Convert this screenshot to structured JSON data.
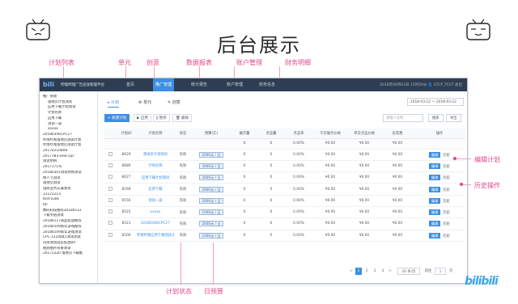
{
  "slide": {
    "title": "后台展示",
    "brand": "bilibili"
  },
  "annotations": {
    "plan_list": "计划列表",
    "unit": "单元",
    "creative": "创意",
    "data_report": "数据报表",
    "account_mgmt": "账户管理",
    "finance_detail": "财务明细",
    "edit_plan": "编辑计划",
    "history_ops": "历史操作",
    "plan_status": "计划状态",
    "daily_budget": "日预算"
  },
  "app": {
    "logo": "bili",
    "name": "哔哩哔哩广告投放管理平台",
    "nav": [
      "首页",
      "推广管理",
      "统计报告",
      "账户管理",
      "财务信息"
    ],
    "top_right": "2018年09月03日 15时20分  👤 STCP_TEST  退出"
  },
  "sidebar": {
    "items": [
      {
        "label": "推广管理",
        "level": 1
      },
      {
        "label": "落地页计划测试",
        "level": 2
      },
      {
        "label": "应用下载计划测试",
        "level": 2
      },
      {
        "label": "计划名称",
        "level": 2
      },
      {
        "label": "应用下载",
        "level": 2
      },
      {
        "label": "测试一波",
        "level": 2
      },
      {
        "label": "xxxxx",
        "level": 2
      },
      {
        "label": "20180306CPC17",
        "level": 1
      },
      {
        "label": "哔哩哔哩落地页测试计划",
        "level": 1
      },
      {
        "label": "哔哩哔哩落地页测试计划",
        "level": 1
      },
      {
        "label": "20170210808",
        "level": 1
      },
      {
        "label": "2017183-new-cpc",
        "level": 1
      },
      {
        "label": "测试用例",
        "level": 1
      },
      {
        "label": "2017171%",
        "level": 1
      },
      {
        "label": "20180301测试用例测试",
        "level": 1
      },
      {
        "label": "情人节测试",
        "level": 1
      },
      {
        "label": "落地页测试",
        "level": 1
      },
      {
        "label": "电商业务实操测试",
        "level": 1
      },
      {
        "label": "12121213",
        "level": 1
      },
      {
        "label": "test-xuke",
        "level": 1
      },
      {
        "label": "tar",
        "level": 1
      },
      {
        "label": "数码科技推荐20180112",
        "level": 1
      },
      {
        "label": "下载专链测试",
        "level": 1
      },
      {
        "label": "20180117商品投放推荐",
        "level": 1
      },
      {
        "label": "20180109新年游戏推荐",
        "level": 1
      },
      {
        "label": "20180109新年游戏测试",
        "level": 1
      },
      {
        "label": "CPC-122测试1测试测试",
        "level": 1
      },
      {
        "label": "内部测试动态投放BA",
        "level": 1
      },
      {
        "label": "视频图片效果测试",
        "level": 1
      },
      {
        "label": "20171220 落地页下载推",
        "level": 1
      }
    ]
  },
  "tabs": [
    "计划",
    "单元",
    "创意"
  ],
  "date_range": "2018-03-12 ～ 2018-03-12",
  "toolbar": {
    "new_plan": "+ 新建计划",
    "enable": "▶ 启用",
    "pause": "‖ 暂停",
    "delete": "🗑 删除",
    "search_placeholder": "请输入名称",
    "search_btn": "搜索",
    "export_btn": "导出"
  },
  "table": {
    "headers": [
      "",
      "计划ID",
      "计划名称",
      "状态",
      "预算(元)",
      "展示量",
      "点击量",
      "点击率",
      "千次展示价格",
      "单次点击价格",
      "总花费",
      "操作"
    ],
    "total_row": [
      "",
      "",
      "",
      "",
      "",
      "0",
      "0",
      "0.00%",
      "¥0.00",
      "¥0.00",
      "¥0.00",
      ""
    ],
    "rows": [
      {
        "id": "8629",
        "name": "落地页计划测试",
        "status": "有效",
        "budget": "2000元 / 日",
        "impr": "0",
        "clicks": "0",
        "ctr": "0.00%",
        "cpm": "¥0.00",
        "cpc": "¥0.00",
        "cost": "¥0.00"
      },
      {
        "id": "8689",
        "name": "计划名称",
        "status": "有效",
        "budget": "3000元 / 日",
        "impr": "0",
        "clicks": "0",
        "ctr": "0.00%",
        "cpm": "¥0.00",
        "cpc": "¥0.00",
        "cost": "¥0.00"
      },
      {
        "id": "8627",
        "name": "应用下载计划测试",
        "status": "有效",
        "budget": "3000元 / 日",
        "impr": "0",
        "clicks": "0",
        "ctr": "0.00%",
        "cpm": "¥0.00",
        "cpc": "¥0.00",
        "cost": "¥0.00"
      },
      {
        "id": "8598",
        "name": "应用下载",
        "status": "有效",
        "budget": "2000元 / 日",
        "impr": "0",
        "clicks": "0",
        "ctr": "0.00%",
        "cpm": "¥0.00",
        "cpc": "¥0.00",
        "cost": "¥0.00"
      },
      {
        "id": "8556",
        "name": "测试一波",
        "status": "有效",
        "budget": "2000元 / 日",
        "impr": "0",
        "clicks": "0",
        "ctr": "0.00%",
        "cpm": "¥0.00",
        "cpc": "¥0.00",
        "cost": "¥0.00"
      },
      {
        "id": "8525",
        "name": "xxxxx",
        "status": "有效",
        "budget": "1000元 / 日",
        "impr": "0",
        "clicks": "0",
        "ctr": "0.00%",
        "cpm": "¥0.00",
        "cpc": "¥0.00",
        "cost": "¥0.00"
      },
      {
        "id": "8521",
        "name": "20180306CPC17",
        "status": "有效",
        "budget": "2000元 / 日",
        "impr": "0",
        "clicks": "0",
        "ctr": "0.00%",
        "cpm": "¥0.00",
        "cpc": "¥0.00",
        "cost": "¥0.00"
      },
      {
        "id": "8506",
        "name": "哔哩哔哩应用下载测试计划",
        "status": "有效",
        "budget": "1000元 / 日",
        "impr": "0",
        "clicks": "0",
        "ctr": "0.00%",
        "cpm": "¥0.00",
        "cpc": "¥0.00",
        "cost": "¥0.00"
      }
    ],
    "edit_label": "编辑",
    "history_label": "历史"
  },
  "pager": {
    "pages": [
      "<",
      "1",
      "2",
      "3",
      "4",
      ">"
    ],
    "per_page": "20 条/页",
    "goto": "前往",
    "goto_value": "1",
    "page_unit": "页"
  }
}
